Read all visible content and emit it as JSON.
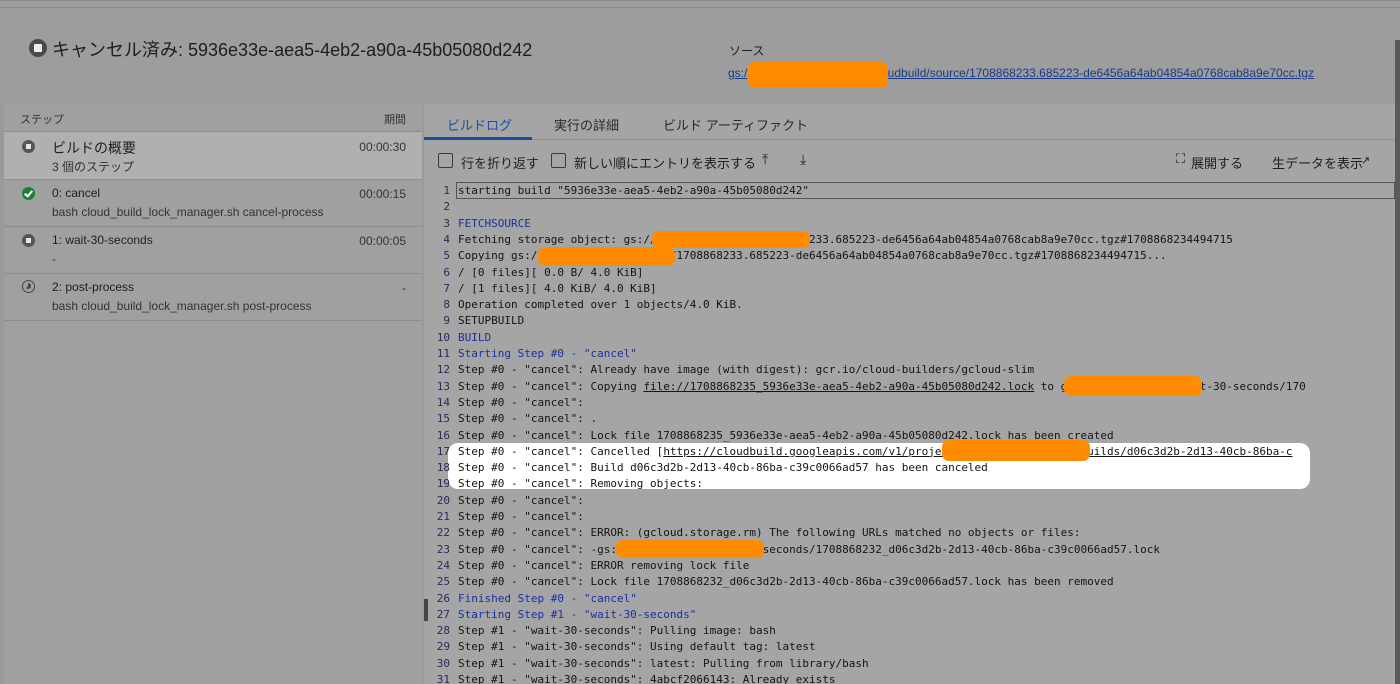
{
  "header": {
    "title": "キャンセル済み: 5936e33e-aea5-4eb2-a90a-45b05080d242",
    "source_label": "ソース",
    "source_prefix": "gs:/",
    "source_suffix": "cloudbuild/source/1708868233.685223-de6456a64ab04854a0768cab8a9e70cc.tgz"
  },
  "steps_panel": {
    "header_left": "ステップ",
    "header_right": "期間",
    "steps": [
      {
        "name": "ビルドの概要",
        "sub": "3 個のステップ",
        "duration": "00:00:30",
        "status": "stop-icon"
      },
      {
        "name": "0: cancel",
        "sub": "bash cloud_build_lock_manager.sh cancel-process",
        "duration": "00:00:15",
        "status": "check-circle-icon"
      },
      {
        "name": "1: wait-30-seconds",
        "sub": "-",
        "duration": "00:00:05",
        "status": "stop-icon"
      },
      {
        "name": "2: post-process",
        "sub": "bash cloud_build_lock_manager.sh post-process",
        "duration": "-",
        "status": "pending-icon"
      }
    ]
  },
  "tabs": [
    {
      "label": "ビルドログ",
      "active": true
    },
    {
      "label": "実行の詳細",
      "active": false
    },
    {
      "label": "ビルド アーティファクト",
      "active": false
    }
  ],
  "toolbar": {
    "wrap_label": "行を折り返す",
    "newest_label": "新しい順にエントリを表示する",
    "expand_label": "展開する",
    "raw_label": "生データを表示",
    "scroll_top_icon": "scroll-top-icon",
    "scroll_bottom_icon": "scroll-bottom-icon"
  },
  "log_lines": [
    {
      "n": "1",
      "t": "starting build \"5936e33e-aea5-4eb2-a90a-45b05080d242\""
    },
    {
      "n": "2",
      "t": ""
    },
    {
      "n": "3",
      "t": "FETCHSOURCE"
    },
    {
      "n": "4",
      "t": "Fetching storage object: gs://                    udbuild/source/1708868233.685223-de6456a64ab04854a0768cab8a9e70cc.tgz#1708868234494715"
    },
    {
      "n": "5",
      "t": "Copying gs://                   _cloudbuild/source/1708868233.685223-de6456a64ab04854a0768cab8a9e70cc.tgz#1708868234494715..."
    },
    {
      "n": "6",
      "t": "/ [0 files][    0.0 B/  4.0 KiB]"
    },
    {
      "n": "7",
      "t": "/ [1 files][  4.0 KiB/  4.0 KiB]"
    },
    {
      "n": "8",
      "t": "Operation completed over 1 objects/4.0 KiB."
    },
    {
      "n": "9",
      "t": "SETUPBUILD"
    },
    {
      "n": "10",
      "t": "BUILD"
    },
    {
      "n": "11",
      "t": "Starting Step #0 - \"cancel\""
    },
    {
      "n": "12",
      "t": "Step #0 - \"cancel\": Already have image (with digest): gcr.io/cloud-builders/gcloud-slim"
    },
    {
      "n": "13",
      "t": "Step #0 - \"cancel\": Copying ",
      "link": "file://1708868235_5936e33e-aea5-4eb2-a90a-45b05080d242.lock",
      "after": " to gs://                   _cloudbuild/wait-30-seconds/170"
    },
    {
      "n": "14",
      "t": "Step #0 - \"cancel\":"
    },
    {
      "n": "15",
      "t": "Step #0 - \"cancel\": ."
    },
    {
      "n": "16",
      "t": "Step #0 - \"cancel\": Lock file 1708868235_5936e33e-aea5-4eb2-a90a-45b05080d242.lock has been created"
    },
    {
      "n": "17",
      "t": "Step #0 - \"cancel\": Cancelled [",
      "link": "https://cloudbuild.googleapis.com/v1/projects                     locations/global/builds/d06c3d2b-2d13-40cb-86ba-c"
    },
    {
      "n": "18",
      "t": "Step #0 - \"cancel\": Build d06c3d2b-2d13-40cb-86ba-c39c0066ad57 has been canceled"
    },
    {
      "n": "19",
      "t": "Step #0 - \"cancel\": Removing objects:"
    },
    {
      "n": "20",
      "t": "Step #0 - \"cancel\":"
    },
    {
      "n": "21",
      "t": "Step #0 - \"cancel\":"
    },
    {
      "n": "22",
      "t": "Step #0 - \"cancel\": ERROR: (gcloud.storage.rm) The following URLs matched no objects or files:"
    },
    {
      "n": "23",
      "t": "Step #0 - \"cancel\": -gs://                    cloudbuild/wait-30-seconds/1708868232_d06c3d2b-2d13-40cb-86ba-c39c0066ad57.lock"
    },
    {
      "n": "24",
      "t": "Step #0 - \"cancel\": ERROR removing lock file"
    },
    {
      "n": "25",
      "t": "Step #0 - \"cancel\": Lock file 1708868232_d06c3d2b-2d13-40cb-86ba-c39c0066ad57.lock has been removed"
    },
    {
      "n": "26",
      "t": "Finished Step #0 - \"cancel\""
    },
    {
      "n": "27",
      "t": "Starting Step #1 - \"wait-30-seconds\""
    },
    {
      "n": "28",
      "t": "Step #1 - \"wait-30-seconds\": Pulling image: bash"
    },
    {
      "n": "29",
      "t": "Step #1 - \"wait-30-seconds\": Using default tag: latest"
    },
    {
      "n": "30",
      "t": "Step #1 - \"wait-30-seconds\": latest: Pulling from library/bash"
    },
    {
      "n": "31",
      "t": "Step #1 - \"wait-30-seconds\": 4abcf2066143: Already exists"
    }
  ],
  "colors": {
    "redaction": "#ff8c00",
    "link": "#1a3a8a",
    "accent": "#1a4fa0",
    "highlight": "#ffffff"
  }
}
